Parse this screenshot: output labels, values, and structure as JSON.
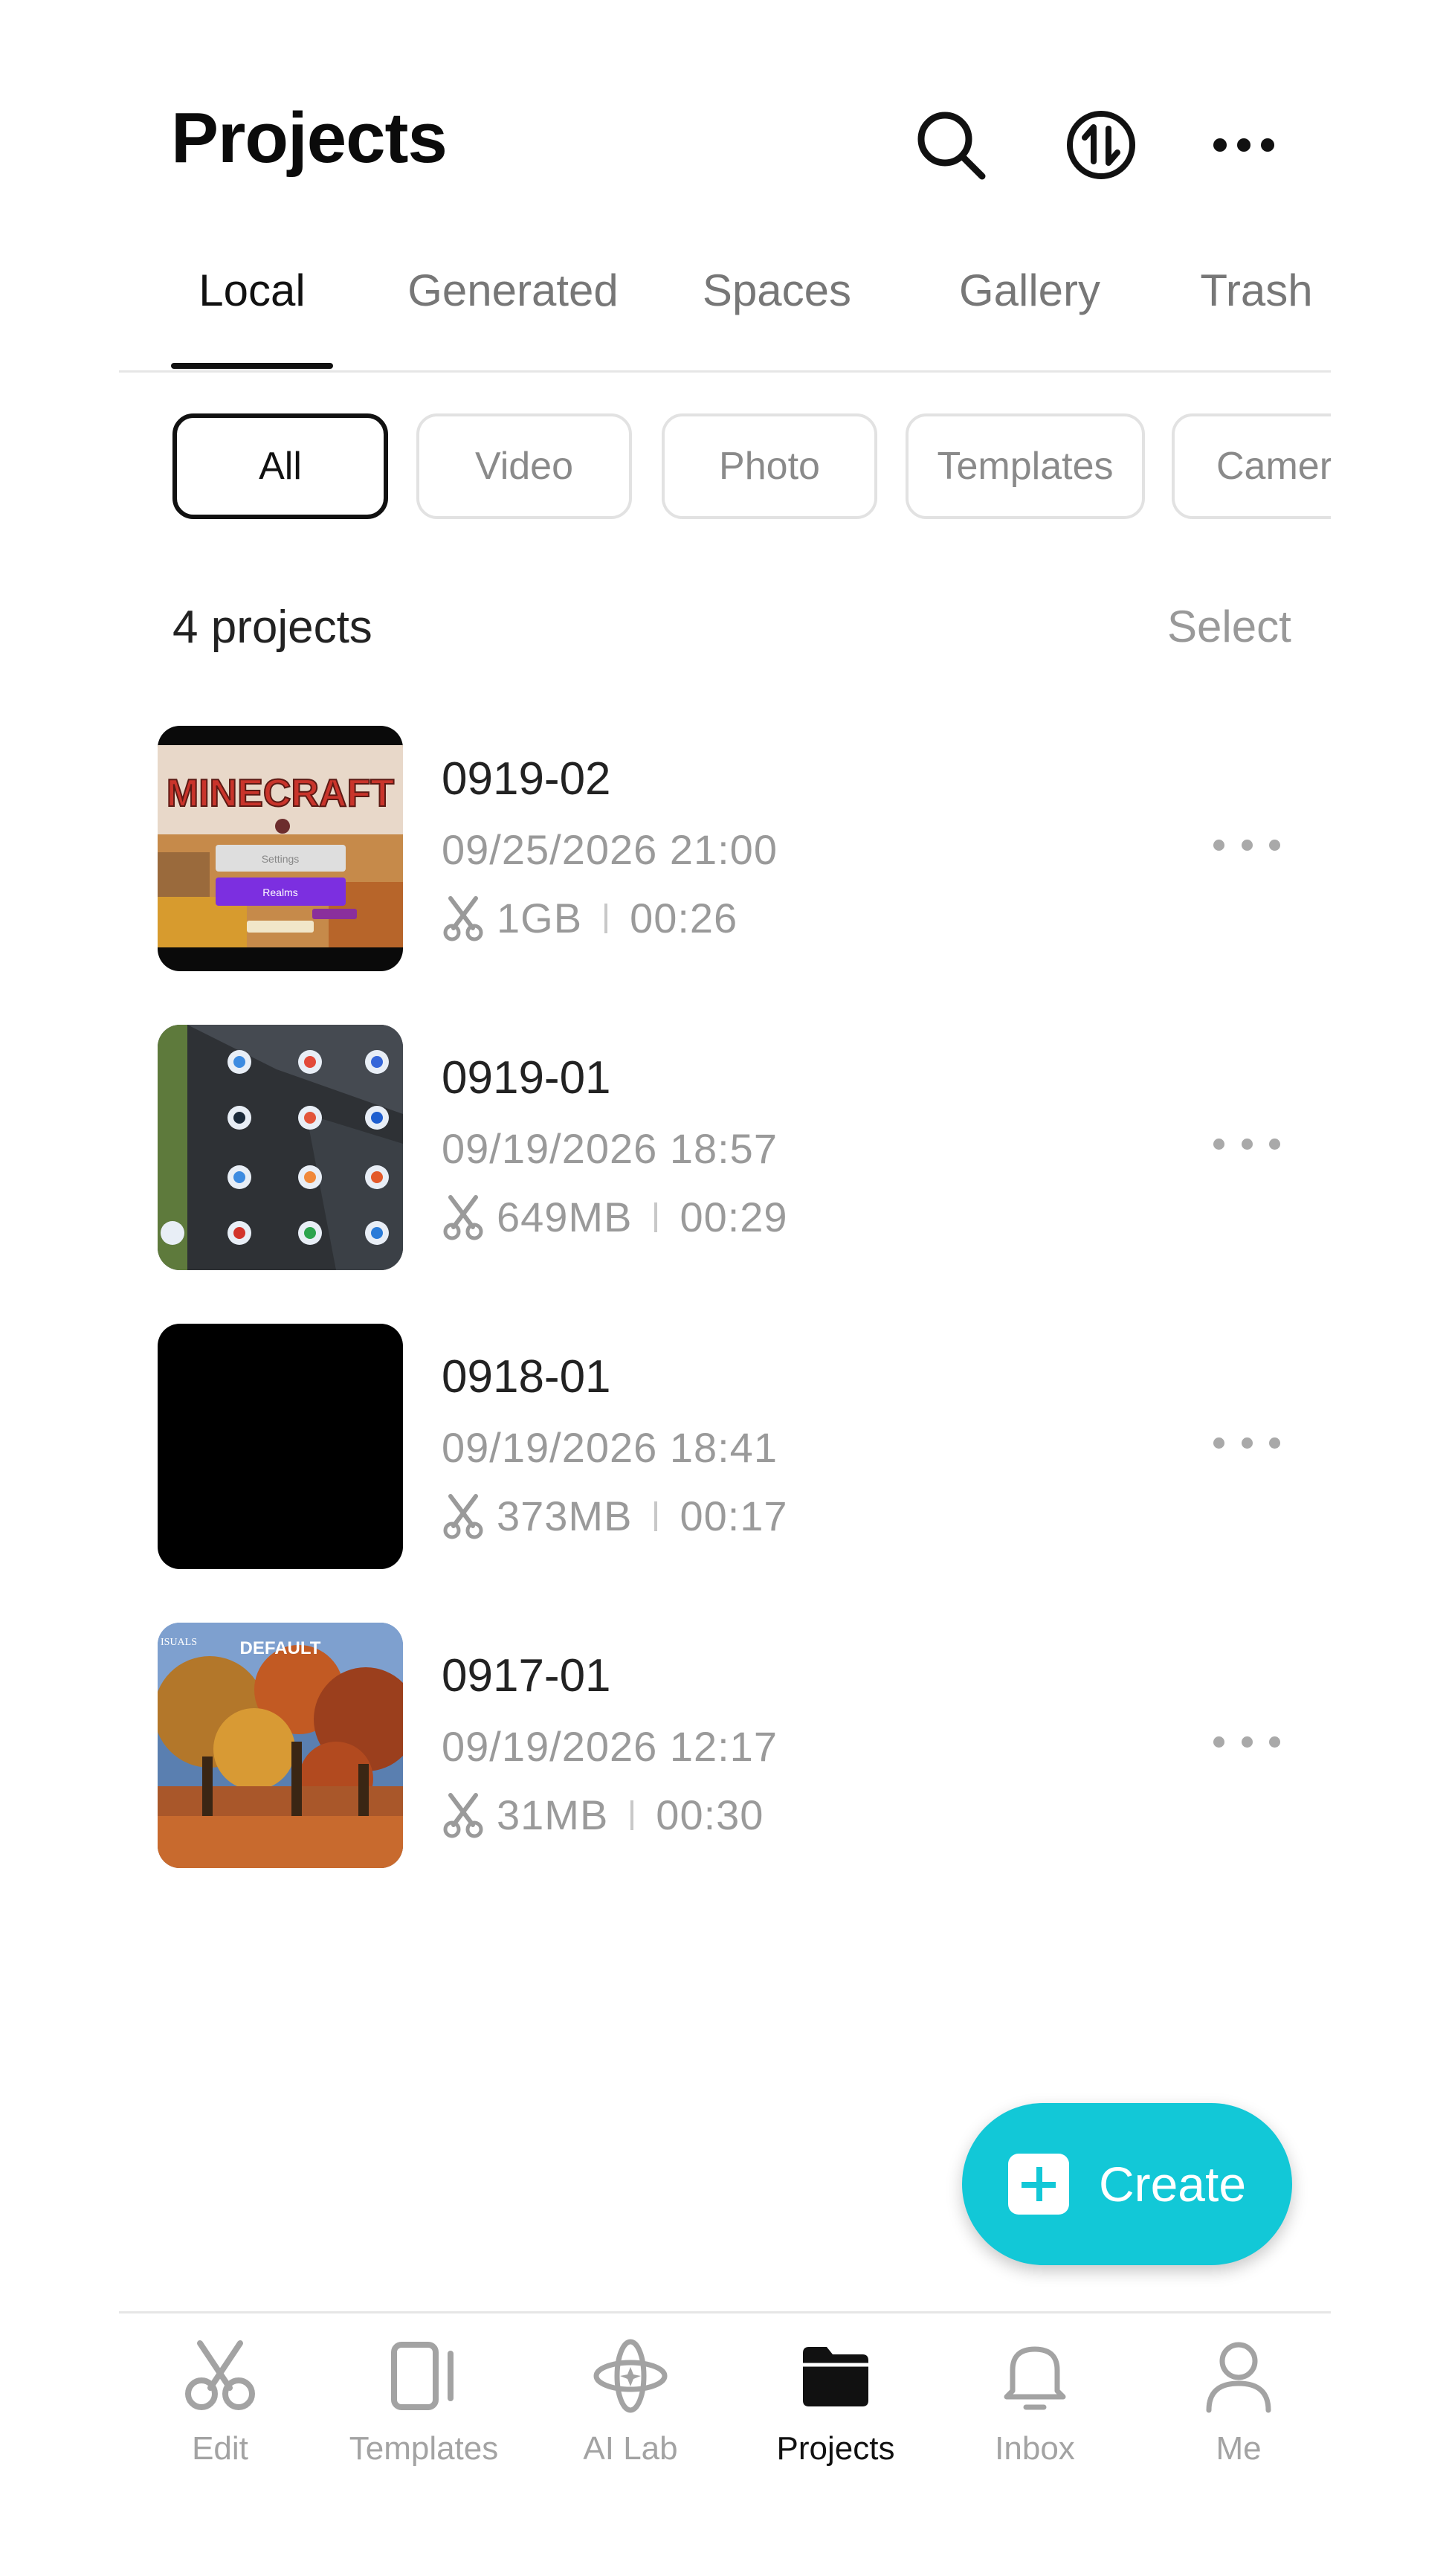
{
  "header": {
    "title": "Projects",
    "icons": [
      "search-icon",
      "sync-icon",
      "more-icon"
    ]
  },
  "tabs": [
    {
      "label": "Local",
      "active": true
    },
    {
      "label": "Generated",
      "active": false
    },
    {
      "label": "Spaces",
      "active": false
    },
    {
      "label": "Gallery",
      "active": false
    },
    {
      "label": "Trash",
      "active": false
    }
  ],
  "filters": [
    {
      "label": "All",
      "active": true
    },
    {
      "label": "Video",
      "active": false
    },
    {
      "label": "Photo",
      "active": false
    },
    {
      "label": "Templates",
      "active": false
    },
    {
      "label": "Camera",
      "active": false
    }
  ],
  "list": {
    "count_label": "4 projects",
    "select_label": "Select"
  },
  "projects": [
    {
      "name": "0919-02",
      "date": "09/25/2026 21:00",
      "size": "1GB",
      "duration": "00:26",
      "thumbnail": "minecraft-menu"
    },
    {
      "name": "0919-01",
      "date": "09/19/2026 18:57",
      "size": "649MB",
      "duration": "00:29",
      "thumbnail": "app-icons-grid"
    },
    {
      "name": "0918-01",
      "date": "09/19/2026 18:41",
      "size": "373MB",
      "duration": "00:17",
      "thumbnail": "black"
    },
    {
      "name": "0917-01",
      "date": "09/19/2026 12:17",
      "size": "31MB",
      "duration": "00:30",
      "thumbnail": "autumn-forest"
    }
  ],
  "thumb_text": {
    "minecraft_logo": "MINECRAFT",
    "minecraft_settings": "Settings",
    "minecraft_realms": "Realms",
    "forest_label": "DEFAULT",
    "forest_corner": "ISUALS"
  },
  "fab": {
    "label": "Create",
    "icon": "plus-icon",
    "color": "#12c8d7"
  },
  "bottom_nav": [
    {
      "label": "Edit",
      "icon": "scissors-icon",
      "active": false
    },
    {
      "label": "Templates",
      "icon": "template-icon",
      "active": false
    },
    {
      "label": "AI Lab",
      "icon": "ai-lab-icon",
      "active": false
    },
    {
      "label": "Projects",
      "icon": "folder-icon",
      "active": true
    },
    {
      "label": "Inbox",
      "icon": "bell-icon",
      "active": false
    },
    {
      "label": "Me",
      "icon": "user-icon",
      "active": false
    }
  ]
}
